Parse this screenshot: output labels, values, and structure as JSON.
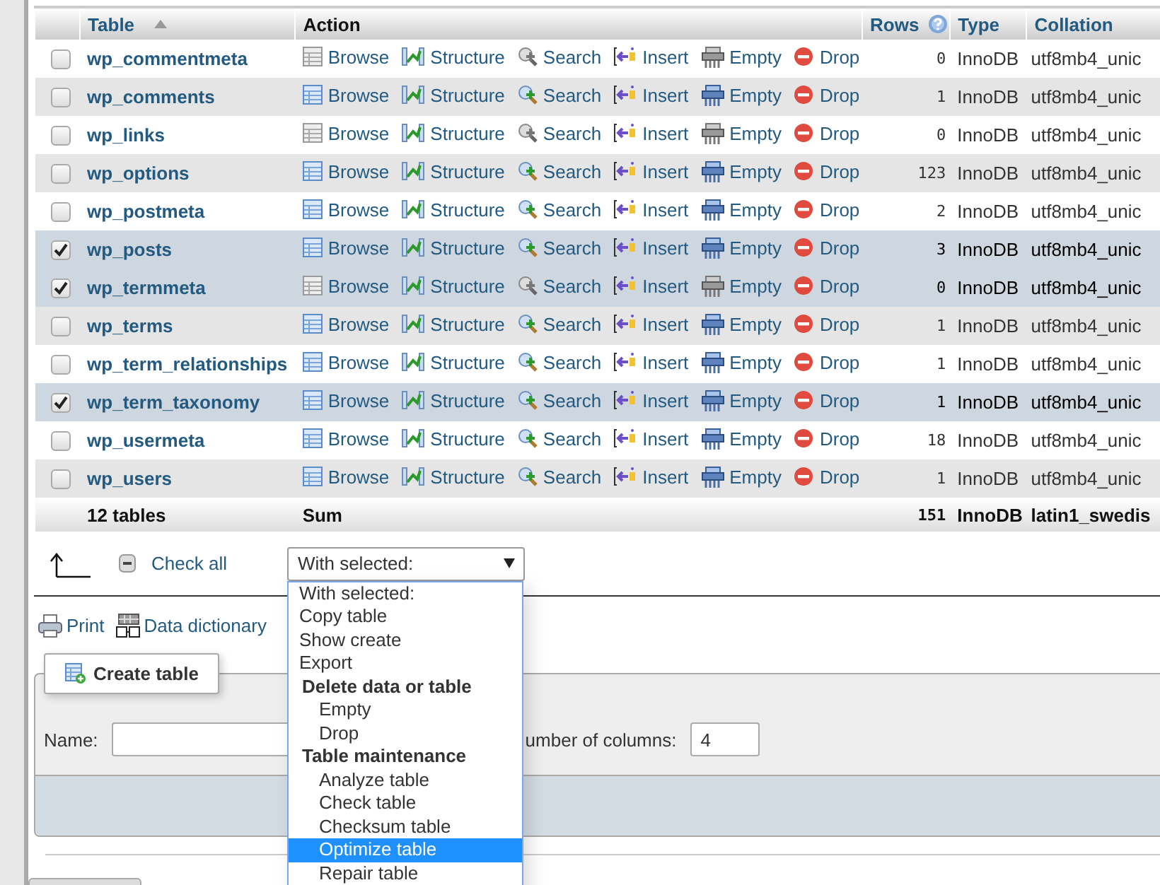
{
  "table": {
    "columns": [
      {
        "label": "Table",
        "sort_icon": true
      },
      {
        "label": "Action"
      },
      {
        "label": "Rows",
        "help_icon": true
      },
      {
        "label": "Type"
      },
      {
        "label": "Collation"
      }
    ],
    "rows": [
      {
        "name": "wp_commentmeta",
        "checked": false,
        "empty": true,
        "actions": [
          "Browse",
          "Structure",
          "Search",
          "Insert",
          "Empty",
          "Drop"
        ],
        "rows": "0",
        "type": "InnoDB",
        "collation": "utf8mb4_unic"
      },
      {
        "name": "wp_comments",
        "checked": false,
        "empty": false,
        "actions": [
          "Browse",
          "Structure",
          "Search",
          "Insert",
          "Empty",
          "Drop"
        ],
        "rows": "1",
        "type": "InnoDB",
        "collation": "utf8mb4_unic"
      },
      {
        "name": "wp_links",
        "checked": false,
        "empty": true,
        "actions": [
          "Browse",
          "Structure",
          "Search",
          "Insert",
          "Empty",
          "Drop"
        ],
        "rows": "0",
        "type": "InnoDB",
        "collation": "utf8mb4_unic"
      },
      {
        "name": "wp_options",
        "checked": false,
        "empty": false,
        "actions": [
          "Browse",
          "Structure",
          "Search",
          "Insert",
          "Empty",
          "Drop"
        ],
        "rows": "123",
        "type": "InnoDB",
        "collation": "utf8mb4_unic"
      },
      {
        "name": "wp_postmeta",
        "checked": false,
        "empty": false,
        "actions": [
          "Browse",
          "Structure",
          "Search",
          "Insert",
          "Empty",
          "Drop"
        ],
        "rows": "2",
        "type": "InnoDB",
        "collation": "utf8mb4_unic"
      },
      {
        "name": "wp_posts",
        "checked": true,
        "empty": false,
        "actions": [
          "Browse",
          "Structure",
          "Search",
          "Insert",
          "Empty",
          "Drop"
        ],
        "rows": "3",
        "type": "InnoDB",
        "collation": "utf8mb4_unic"
      },
      {
        "name": "wp_termmeta",
        "checked": true,
        "empty": true,
        "actions": [
          "Browse",
          "Structure",
          "Search",
          "Insert",
          "Empty",
          "Drop"
        ],
        "rows": "0",
        "type": "InnoDB",
        "collation": "utf8mb4_unic"
      },
      {
        "name": "wp_terms",
        "checked": false,
        "empty": false,
        "actions": [
          "Browse",
          "Structure",
          "Search",
          "Insert",
          "Empty",
          "Drop"
        ],
        "rows": "1",
        "type": "InnoDB",
        "collation": "utf8mb4_unic"
      },
      {
        "name": "wp_term_relationships",
        "checked": false,
        "empty": false,
        "actions": [
          "Browse",
          "Structure",
          "Search",
          "Insert",
          "Empty",
          "Drop"
        ],
        "rows": "1",
        "type": "InnoDB",
        "collation": "utf8mb4_unic"
      },
      {
        "name": "wp_term_taxonomy",
        "checked": true,
        "empty": false,
        "actions": [
          "Browse",
          "Structure",
          "Search",
          "Insert",
          "Empty",
          "Drop"
        ],
        "rows": "1",
        "type": "InnoDB",
        "collation": "utf8mb4_unic"
      },
      {
        "name": "wp_usermeta",
        "checked": false,
        "empty": false,
        "actions": [
          "Browse",
          "Structure",
          "Search",
          "Insert",
          "Empty",
          "Drop"
        ],
        "rows": "18",
        "type": "InnoDB",
        "collation": "utf8mb4_unic"
      },
      {
        "name": "wp_users",
        "checked": false,
        "empty": false,
        "actions": [
          "Browse",
          "Structure",
          "Search",
          "Insert",
          "Empty",
          "Drop"
        ],
        "rows": "1",
        "type": "InnoDB",
        "collation": "utf8mb4_unic"
      }
    ],
    "footer": {
      "count": "12 tables",
      "action": "Sum",
      "rows": "151",
      "type": "InnoDB",
      "collation": "latin1_swedis"
    }
  },
  "bulk": {
    "check_all": "Check all",
    "select_value": "With selected:",
    "options": [
      {
        "label": "With selected:",
        "kind": "option",
        "selected": false
      },
      {
        "label": "Copy table",
        "kind": "option",
        "selected": false
      },
      {
        "label": "Show create",
        "kind": "option",
        "selected": false
      },
      {
        "label": "Export",
        "kind": "option",
        "selected": false
      },
      {
        "label": "Delete data or table",
        "kind": "group",
        "children": [
          {
            "label": "Empty",
            "selected": false
          },
          {
            "label": "Drop",
            "selected": false
          }
        ]
      },
      {
        "label": "Table maintenance",
        "kind": "group",
        "children": [
          {
            "label": "Analyze table",
            "selected": false
          },
          {
            "label": "Check table",
            "selected": false
          },
          {
            "label": "Checksum table",
            "selected": false
          },
          {
            "label": "Optimize table",
            "selected": true
          },
          {
            "label": "Repair table",
            "selected": false
          }
        ]
      }
    ]
  },
  "links": [
    {
      "label": "Print",
      "kind": "print"
    },
    {
      "label": "Data dictionary",
      "kind": "dictionary"
    }
  ],
  "create_table": {
    "legend": "Create table",
    "name_label": "Name:",
    "columns_label": "umber of columns:",
    "columns_value": "4"
  }
}
